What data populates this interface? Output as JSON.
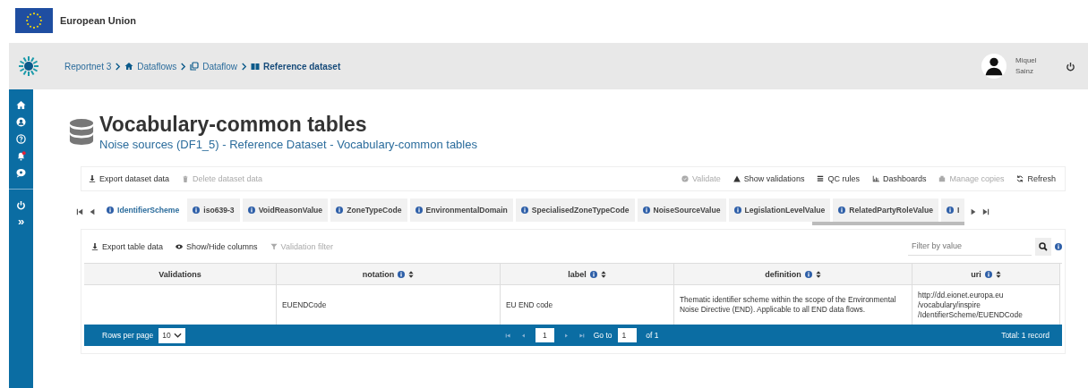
{
  "eu_bar": {
    "label": "European Union"
  },
  "header": {
    "breadcrumbs": [
      {
        "label": "Reportnet 3",
        "current": false
      },
      {
        "label": "Dataflows",
        "current": false
      },
      {
        "label": "Dataflow",
        "current": false
      },
      {
        "label": "Reference dataset",
        "current": true
      }
    ],
    "user": {
      "name": "Miquel Sainz"
    }
  },
  "sidebar": {
    "expand": "»"
  },
  "page": {
    "title": "Vocabulary-common tables",
    "subtitle": "Noise sources (DF1_5) - Reference Dataset - Vocabulary-common tables"
  },
  "dataset_actions": [
    {
      "label": "Export dataset data",
      "disabled": false
    },
    {
      "label": "Delete dataset data",
      "disabled": true
    },
    {
      "label": "Validate",
      "disabled": true
    },
    {
      "label": "Show validations",
      "disabled": false
    },
    {
      "label": "QC rules",
      "disabled": false
    },
    {
      "label": "Dashboards",
      "disabled": false
    },
    {
      "label": "Manage copies",
      "disabled": true
    },
    {
      "label": "Refresh",
      "disabled": false
    }
  ],
  "tabs": [
    {
      "label": "IdentifierScheme",
      "selected": true
    },
    {
      "label": "iso639-3",
      "selected": false
    },
    {
      "label": "VoidReasonValue",
      "selected": false
    },
    {
      "label": "ZoneTypeCode",
      "selected": false
    },
    {
      "label": "EnvironmentalDomain",
      "selected": false
    },
    {
      "label": "SpecialisedZoneTypeCode",
      "selected": false
    },
    {
      "label": "NoiseSourceValue",
      "selected": false
    },
    {
      "label": "LegislationLevelValue",
      "selected": false
    },
    {
      "label": "RelatedPartyRoleValue",
      "selected": false
    },
    {
      "label": "I",
      "selected": false
    }
  ],
  "table_actions": [
    {
      "label": "Export table data",
      "disabled": false
    },
    {
      "label": "Show/Hide columns",
      "disabled": false
    },
    {
      "label": "Validation filter",
      "disabled": true
    }
  ],
  "filter": {
    "placeholder": "Filter by value"
  },
  "table": {
    "columns": [
      {
        "label": "Validations",
        "sortable": false
      },
      {
        "label": "notation",
        "sortable": true
      },
      {
        "label": "label",
        "sortable": true
      },
      {
        "label": "definition",
        "sortable": true
      },
      {
        "label": "uri",
        "sortable": true
      }
    ],
    "rows": [
      [
        "",
        "EUENDCode",
        "EU END code",
        "Thematic identifier scheme within the scope of the Environmental Noise Directive (END). Applicable to all END data flows.",
        "http://dd.eionet.europa.eu /vocabulary/inspire /IdentifierScheme/EUENDCode"
      ]
    ]
  },
  "paginator": {
    "rows_label": "Rows per page",
    "rows_value": "10",
    "page": "1",
    "goto_label": "Go to",
    "goto_value": "1",
    "of": "of 1",
    "total": "Total: 1 record"
  }
}
